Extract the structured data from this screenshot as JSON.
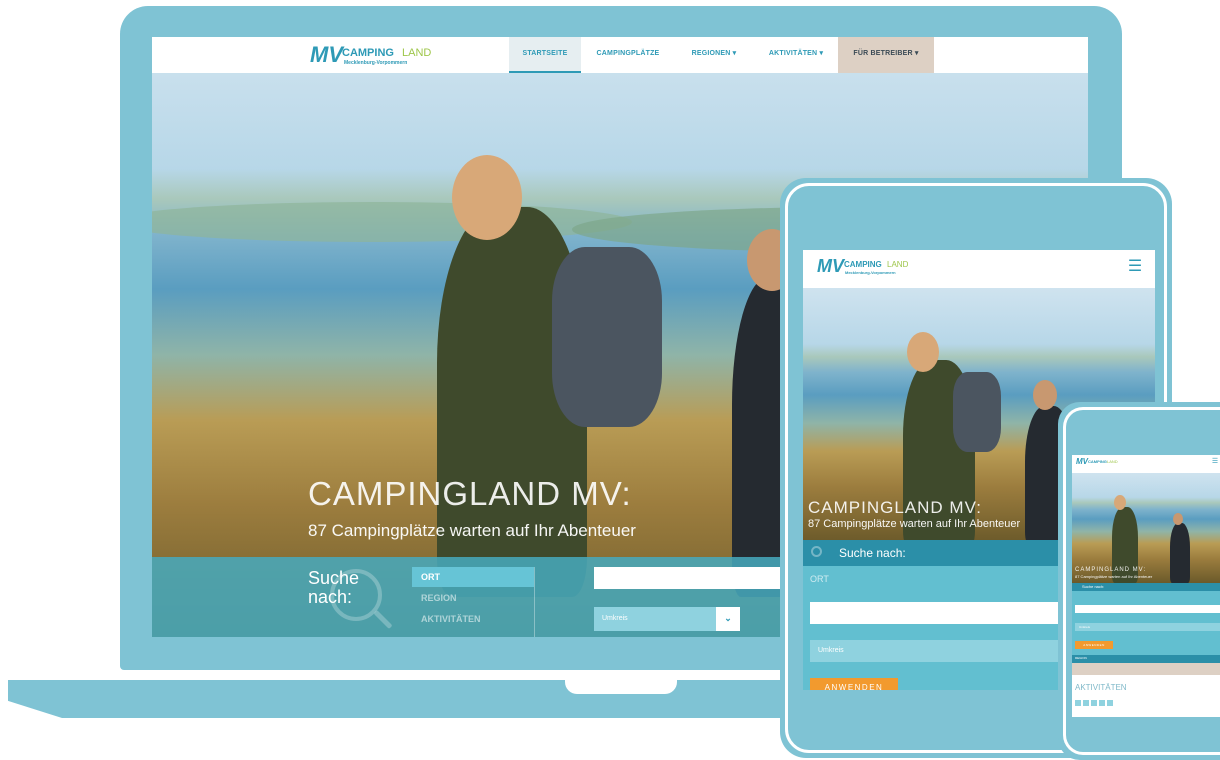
{
  "brand": {
    "logo_mv": "MV",
    "logo_camping": "CAMPING",
    "logo_land": "LAND",
    "logo_sub": "Mecklenburg-Vorpommern",
    "color_primary": "#2e9ab6",
    "color_accent": "#f29a2e",
    "color_device": "#7fc3d4"
  },
  "nav": {
    "items": [
      {
        "label": "STARTSEITE"
      },
      {
        "label": "CAMPINGPLÄTZE"
      },
      {
        "label": "REGIONEN ▾"
      },
      {
        "label": "AKTIVITÄTEN ▾"
      },
      {
        "label": "FÜR BETREIBER ▾"
      }
    ],
    "menu_icon": "hamburger-icon"
  },
  "hero": {
    "title": "CAMPINGLAND MV:",
    "subtitle": "87 Campingplätze warten auf Ihr Abenteuer"
  },
  "search": {
    "label_line1": "Suche",
    "label_line2": "nach:",
    "label_single": "Suche nach:",
    "options": [
      {
        "label": "ORT"
      },
      {
        "label": "REGION"
      },
      {
        "label": "AKTIVITÄTEN"
      }
    ],
    "umkreis_placeholder": "Umkreis",
    "apply_label": "ANWENDEN",
    "icon": "search-icon"
  },
  "phone": {
    "aktivitaeten_label": "AKTIVITÄTEN"
  }
}
